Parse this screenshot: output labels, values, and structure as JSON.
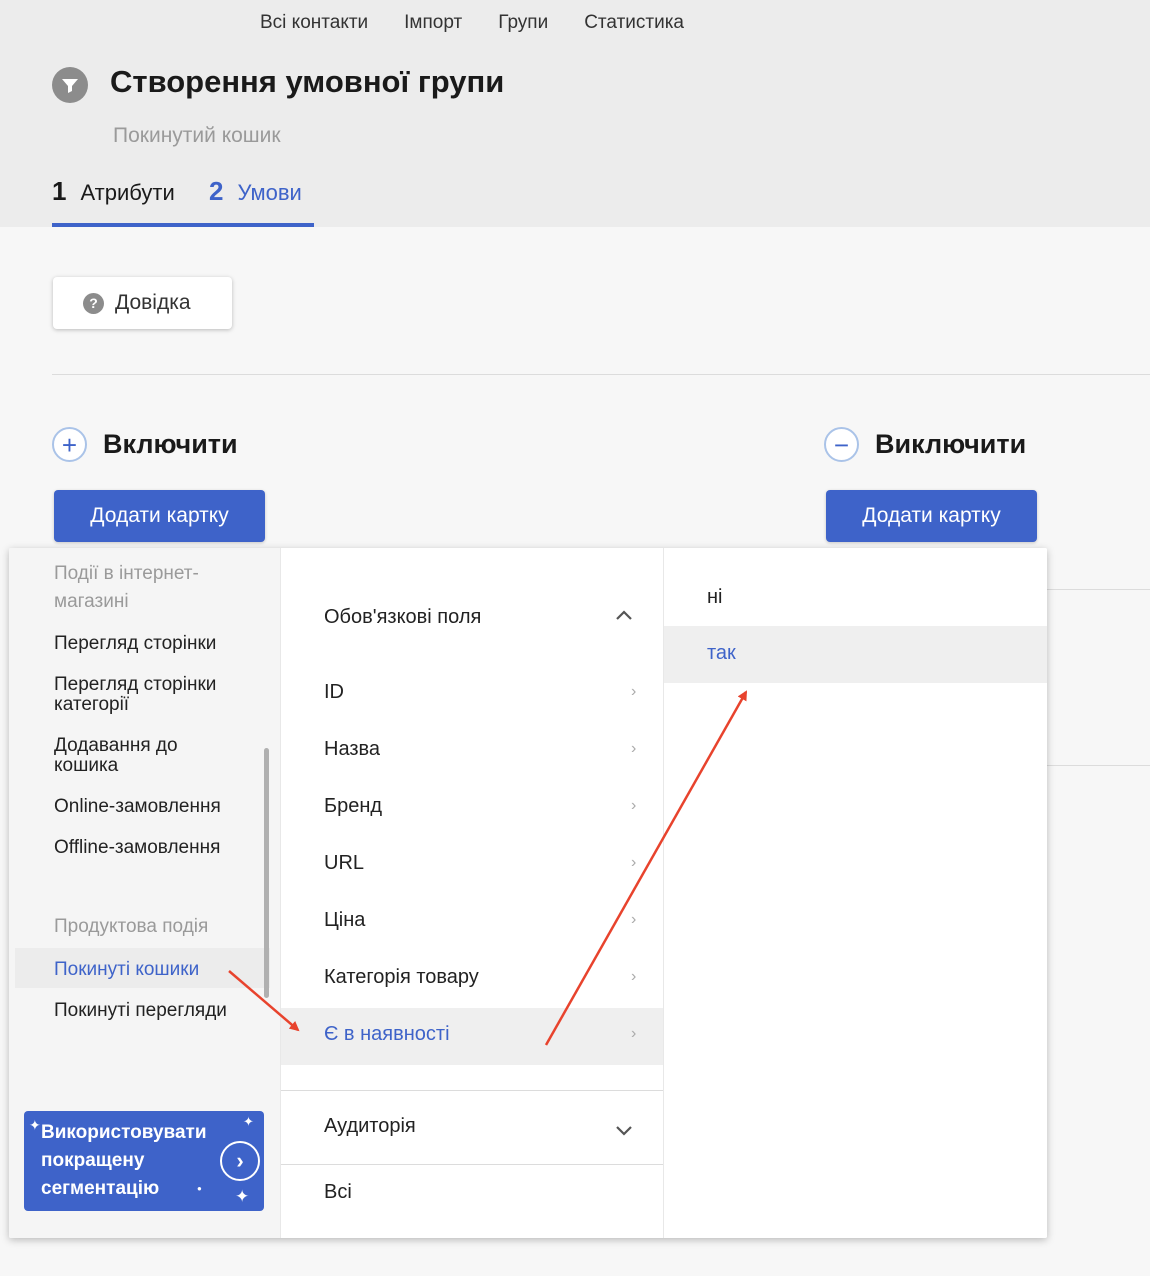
{
  "topnav": [
    "Всі контакти",
    "Імпорт",
    "Групи",
    "Статистика"
  ],
  "title": "Створення умовної групи",
  "subtitle": "Покинутий кошик",
  "steps": [
    {
      "num": "1",
      "label": "Атрибути"
    },
    {
      "num": "2",
      "label": "Умови"
    }
  ],
  "help_label": "Довідка",
  "include": {
    "title": "Включити",
    "add_label": "Додати картку",
    "icon": "+"
  },
  "exclude": {
    "title": "Виключити",
    "add_label": "Додати картку",
    "icon": "−"
  },
  "menu1": {
    "head_top": "Події в інтернет-",
    "head_top2": "магазині",
    "events": [
      "Перегляд сторінки",
      "Перегляд сторінки",
      "категорії",
      "Додавання до",
      "кошика",
      "Online-замовлення",
      "Offline-замовлення"
    ],
    "product_head": "Продуктова подія",
    "product_items": [
      "Покинуті кошики",
      "Покинуті перегляди"
    ],
    "promo_lines": [
      "Використовувати",
      "покращену",
      "сегментацію"
    ]
  },
  "menu2": {
    "section_head": "Обов'язкові поля",
    "fields": [
      "ID",
      "Назва",
      "Бренд",
      "URL",
      "Ціна",
      "Категорія товару",
      "Є в наявності"
    ],
    "audience_head": "Аудиторія",
    "all_label": "Всі"
  },
  "menu3": {
    "options": [
      "ні",
      "так"
    ]
  },
  "colors": {
    "accent": "#3e63c9",
    "annotation": "#e8432d"
  }
}
